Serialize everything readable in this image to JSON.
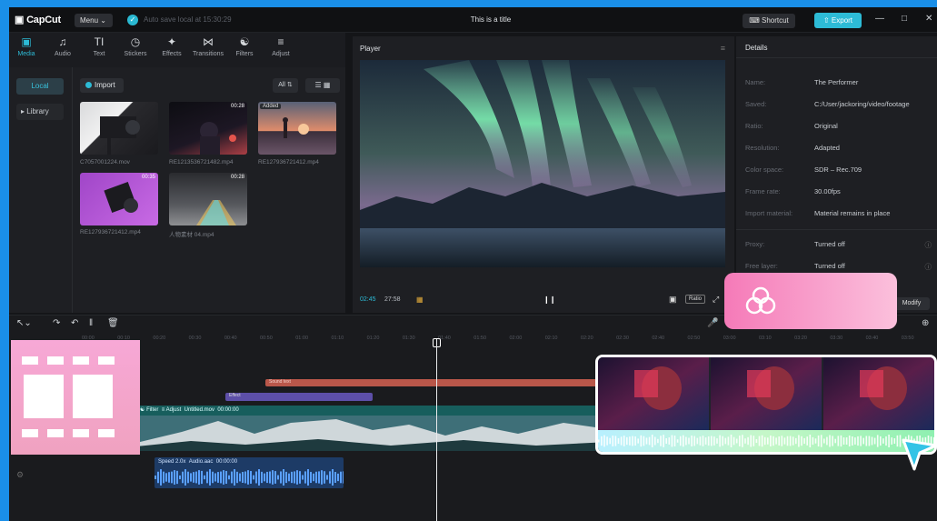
{
  "app": {
    "logo": "CapCut",
    "menu_label": "Menu",
    "autosave": "Auto save local at 15:30:29",
    "title": "This is a title",
    "shortcut_label": "Shortcut",
    "export_label": "Export"
  },
  "tool_tabs": [
    {
      "label": "Media",
      "icon": "media-icon",
      "active": true
    },
    {
      "label": "Audio",
      "icon": "audio-icon",
      "active": false
    },
    {
      "label": "Text",
      "icon": "text-icon",
      "active": false
    },
    {
      "label": "Stickers",
      "icon": "stickers-icon",
      "active": false
    },
    {
      "label": "Effects",
      "icon": "effects-icon",
      "active": false
    },
    {
      "label": "Transitions",
      "icon": "transitions-icon",
      "active": false
    },
    {
      "label": "Filters",
      "icon": "filters-icon",
      "active": false
    },
    {
      "label": "Adjust",
      "icon": "adjust-icon",
      "active": false
    }
  ],
  "media": {
    "side_local": "Local",
    "side_library": "Library",
    "import_label": "Import",
    "filter_label": "All",
    "items": [
      {
        "name": "C7057001224.mov",
        "duration": ""
      },
      {
        "name": "RE1213536721482.mp4",
        "duration": "00:28"
      },
      {
        "name": "RE127936721412.mp4",
        "duration": "",
        "badge": "Added"
      },
      {
        "name": "RE127936721412.mp4",
        "duration": "00:35"
      },
      {
        "name": "人物素材 04.mp4",
        "duration": "00:28"
      }
    ]
  },
  "player": {
    "header": "Player",
    "current_time": "02:45",
    "total_time": "27:58",
    "ratio_label": "Ratio"
  },
  "details": {
    "header": "Details",
    "rows": [
      {
        "key": "Name:",
        "value": "The Performer"
      },
      {
        "key": "Saved:",
        "value": "C:/User/jackoring/video/footage"
      },
      {
        "key": "Ratio:",
        "value": "Original"
      },
      {
        "key": "Resolution:",
        "value": "Adapted"
      },
      {
        "key": "Color space:",
        "value": "SDR – Rec.709"
      },
      {
        "key": "Frame rate:",
        "value": "30.00fps"
      },
      {
        "key": "Import material:",
        "value": "Material remains in place"
      },
      {
        "key": "Proxy:",
        "value": "Turned off"
      },
      {
        "key": "Free layer:",
        "value": "Turned off"
      }
    ],
    "modify_label": "Modify"
  },
  "timeline": {
    "ticks": [
      "00:00",
      "00:10",
      "00:20",
      "00:30",
      "00:40",
      "00:50",
      "01:00",
      "01:10",
      "01:20",
      "01:30",
      "01:40",
      "01:50",
      "02:00",
      "02:10",
      "02:20",
      "02:30",
      "02:40",
      "02:50",
      "03:00",
      "03:10",
      "03:20",
      "03:30",
      "03:40",
      "03:50"
    ],
    "red_clip_label": "Sound text",
    "purple_clip_label": "Effect",
    "main_clip_filter": "Filter",
    "main_clip_adjust": "Adjust",
    "main_clip_name": "Untitled.mov",
    "main_clip_duration": "00:00:00",
    "audio_speed": "Speed 2.0x",
    "audio_name": "Audio.aac",
    "audio_duration": "00:00:00"
  },
  "colors": {
    "accent": "#2dbbd6",
    "frame": "#1a8fe8",
    "pink": "#f57ab8"
  }
}
